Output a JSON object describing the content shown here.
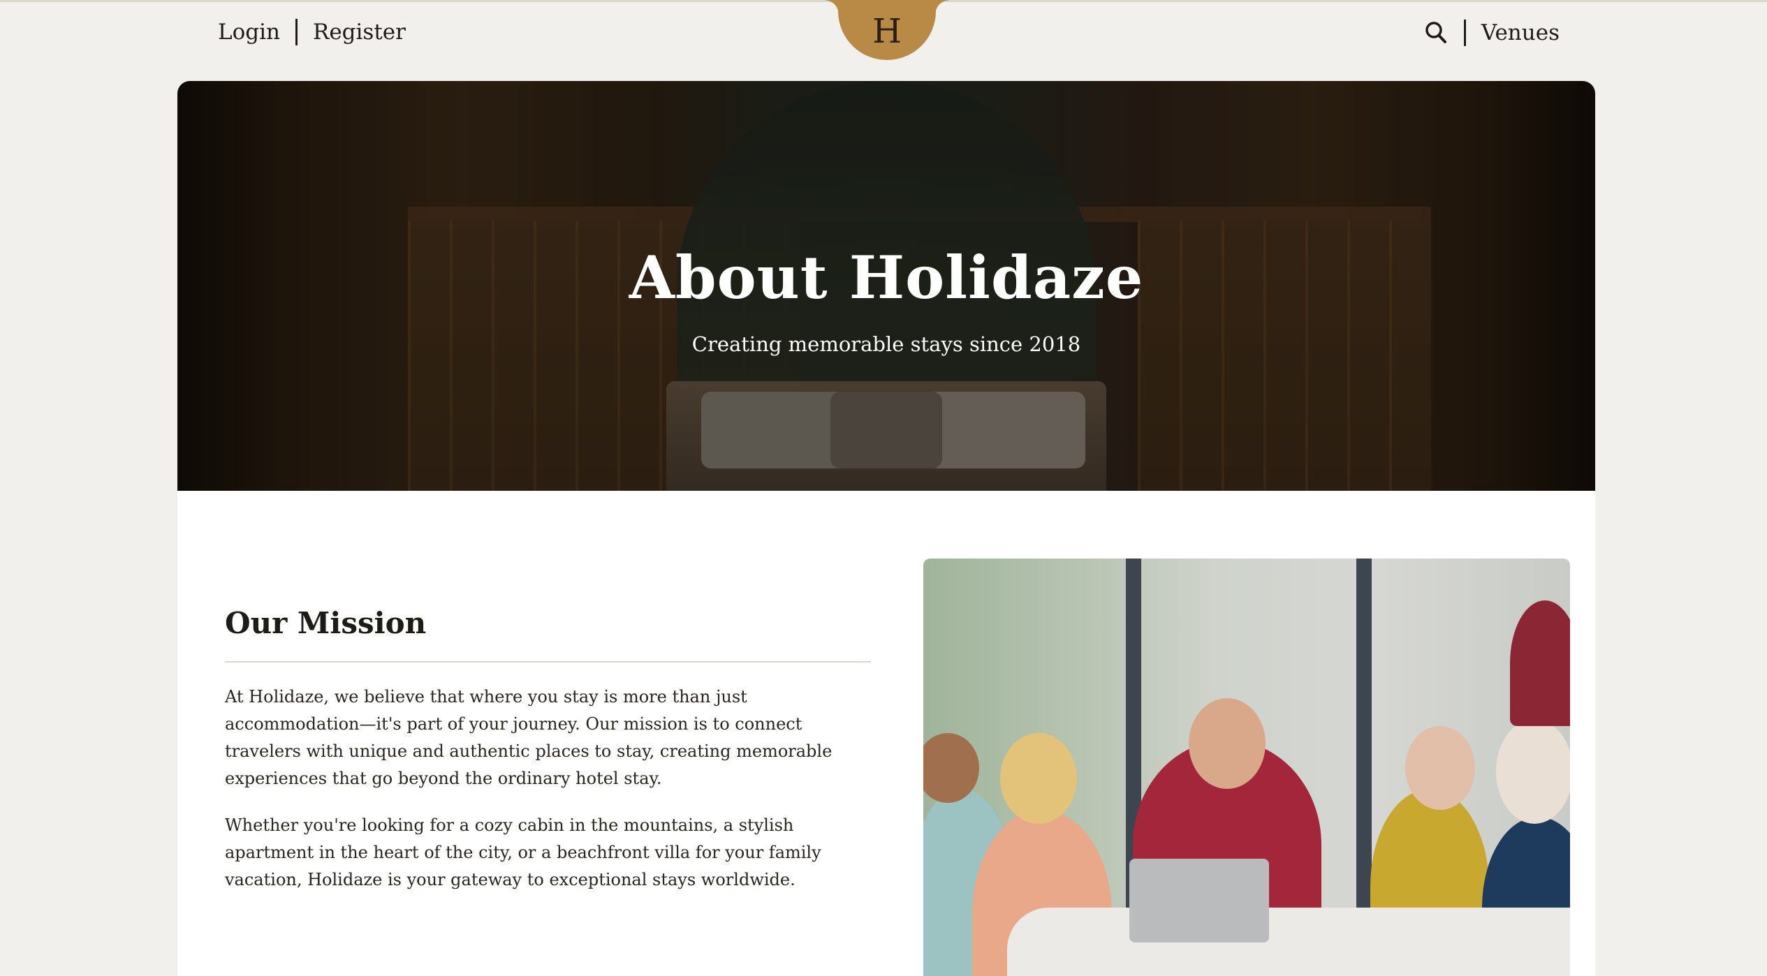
{
  "header": {
    "login_label": "Login",
    "register_label": "Register",
    "logo_letter": "H",
    "venues_label": "Venues",
    "search_icon": "search-icon"
  },
  "hero": {
    "title": "About Holidaze",
    "subtitle": "Creating memorable stays since 2018"
  },
  "mission": {
    "heading": "Our Mission",
    "paragraph_1": "At Holidaze, we believe that where you stay is more than just accommodation—it's part of your journey. Our mission is to connect travelers with unique and authentic places to stay, creating memorable experiences that go beyond the ordinary hotel stay.",
    "paragraph_2": "Whether you're looking for a cozy cabin in the mountains, a stylish apartment in the heart of the city, or a beachfront villa for your family vacation, Holidaze is your gateway to exceptional stays worldwide."
  },
  "colors": {
    "page_background": "#f2f0ec",
    "accent": "#b88a46",
    "text": "#1f1b16",
    "card": "#ffffff"
  }
}
